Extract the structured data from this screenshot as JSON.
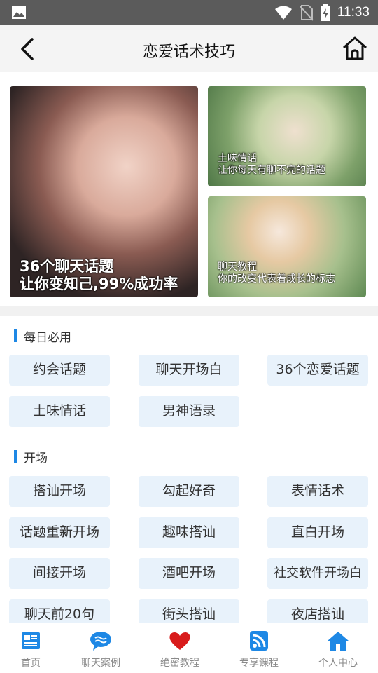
{
  "status_bar": {
    "time": "11:33"
  },
  "header": {
    "title": "恋爱话术技巧"
  },
  "banners": [
    {
      "line1": "36个聊天话题",
      "line2": "让你变知己,99%成功率"
    },
    {
      "line1": "土味情话",
      "line2": "让你每天有聊不完的话题"
    },
    {
      "line1": "聊天教程",
      "line2": "你的改变代表着成长的标志"
    }
  ],
  "sections": [
    {
      "title": "每日必用",
      "items": [
        "约会话题",
        "聊天开场白",
        "36个恋爱话题",
        "土味情话",
        "男神语录"
      ]
    },
    {
      "title": "开场",
      "items": [
        "搭讪开场",
        "勾起好奇",
        "表情话术",
        "话题重新开场",
        "趣味搭讪",
        "直白开场",
        "间接开场",
        "酒吧开场",
        "社交软件开场白",
        "聊天前20句",
        "街头搭讪",
        "夜店搭讪"
      ]
    }
  ],
  "bottom_nav": [
    {
      "label": "首页",
      "icon": "news-icon"
    },
    {
      "label": "聊天案例",
      "icon": "chat-bubble-icon"
    },
    {
      "label": "绝密教程",
      "icon": "heart-icon"
    },
    {
      "label": "专享课程",
      "icon": "rss-icon"
    },
    {
      "label": "个人中心",
      "icon": "home-icon"
    }
  ],
  "colors": {
    "accent": "#1e88e5",
    "chip_bg": "#e8f2fb",
    "heart": "#d81b1b"
  }
}
